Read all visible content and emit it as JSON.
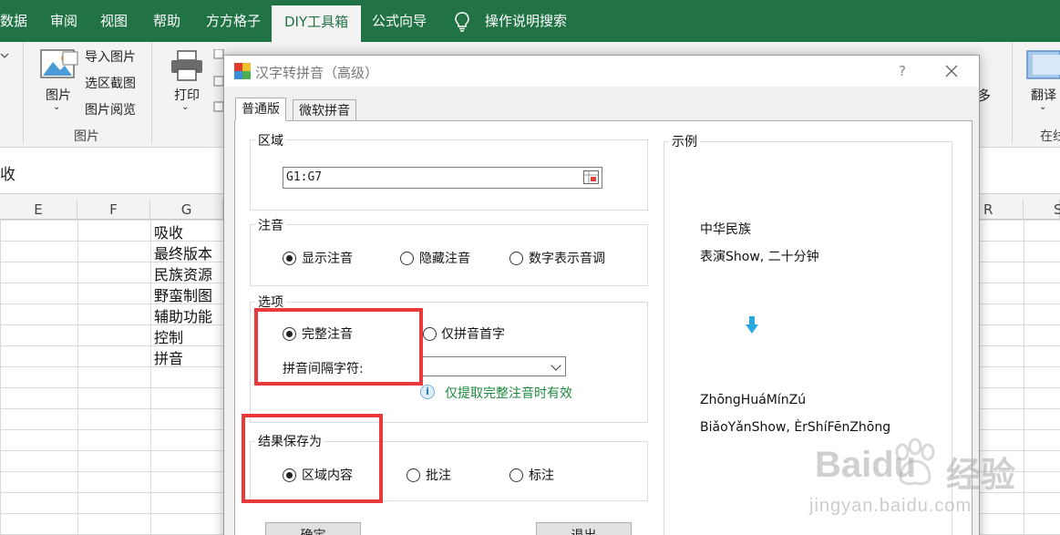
{
  "ribbon_tabs": [
    "数据",
    "审阅",
    "视图",
    "帮助",
    "方方格子",
    "DIY工具箱",
    "公式向导",
    "操作说明搜索"
  ],
  "active_tab": "DIY工具箱",
  "ribbon": {
    "picture_button": "图片",
    "import_picture": "导入图片",
    "region_screenshot": "选区截图",
    "picture_browse": "图片阅览",
    "picture_group": "图片",
    "print_button": "打印",
    "more_label": "多",
    "translate_button": "翻译",
    "right_group_partial": "在线"
  },
  "formula_bar": {
    "partial_text": "收"
  },
  "grid": {
    "columns": [
      "E",
      "F",
      "G",
      "R",
      "S"
    ],
    "g_values": [
      "吸收",
      "最终版本",
      "民族资源",
      "野蛮制图",
      "辅助功能",
      "控制",
      "拼音"
    ]
  },
  "dialog": {
    "title": "汉字转拼音（高级）",
    "help_label": "?",
    "tabs": [
      "普通版",
      "微软拼音"
    ],
    "region_section": "区域",
    "region_value": "G1:G7",
    "annotation_section": "注音",
    "annotation_options": [
      "显示注音",
      "隐藏注音",
      "数字表示音调"
    ],
    "options_section": "选项",
    "full_annotation": "完整注音",
    "initials_only": "仅拼音首字",
    "separator_label": "拼音间隔字符:",
    "hint": "仅提取完整注音时有效",
    "save_section": "结果保存为",
    "save_options": [
      "区域内容",
      "批注",
      "标注"
    ],
    "example_section": "示例",
    "example_input": [
      "中华民族",
      "表演Show, 二十分钟"
    ],
    "example_output": [
      "ZhōngHuáMínZú",
      "BiǎoYǎnShow, ÈrShíFēnZhōng"
    ],
    "ok_button": "确定",
    "exit_button": "退出"
  },
  "watermark": {
    "brand": "Baidu",
    "brand_cn": "经验",
    "url": "jingyan.baidu.com"
  },
  "colors": {
    "excel_green": "#217346",
    "highlight_red": "#e83a3a",
    "hint_green": "#1c8a3c",
    "arrow_blue": "#2aa8e0"
  }
}
